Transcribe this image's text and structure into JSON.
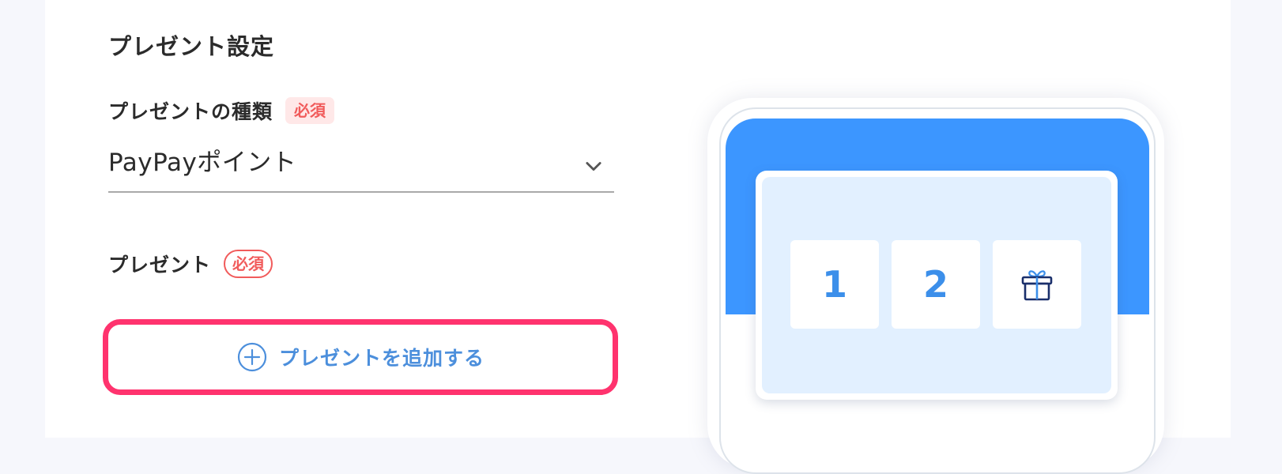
{
  "section": {
    "title": "プレゼント設定"
  },
  "present_type": {
    "label": "プレゼントの種類",
    "required_badge": "必須",
    "selected_value": "PayPayポイント"
  },
  "present": {
    "label": "プレゼント",
    "required_badge": "必須",
    "add_button_label": "プレゼントを追加する"
  },
  "preview": {
    "tiles": [
      {
        "label": "1"
      },
      {
        "label": "2"
      },
      {
        "icon": "gift-icon"
      }
    ]
  },
  "colors": {
    "accent_blue": "#3c96ff",
    "button_text_blue": "#4c8fdc",
    "highlight_pink": "#ff336e",
    "required_red": "#f15b5b",
    "card_bg": "#e2f0ff"
  }
}
